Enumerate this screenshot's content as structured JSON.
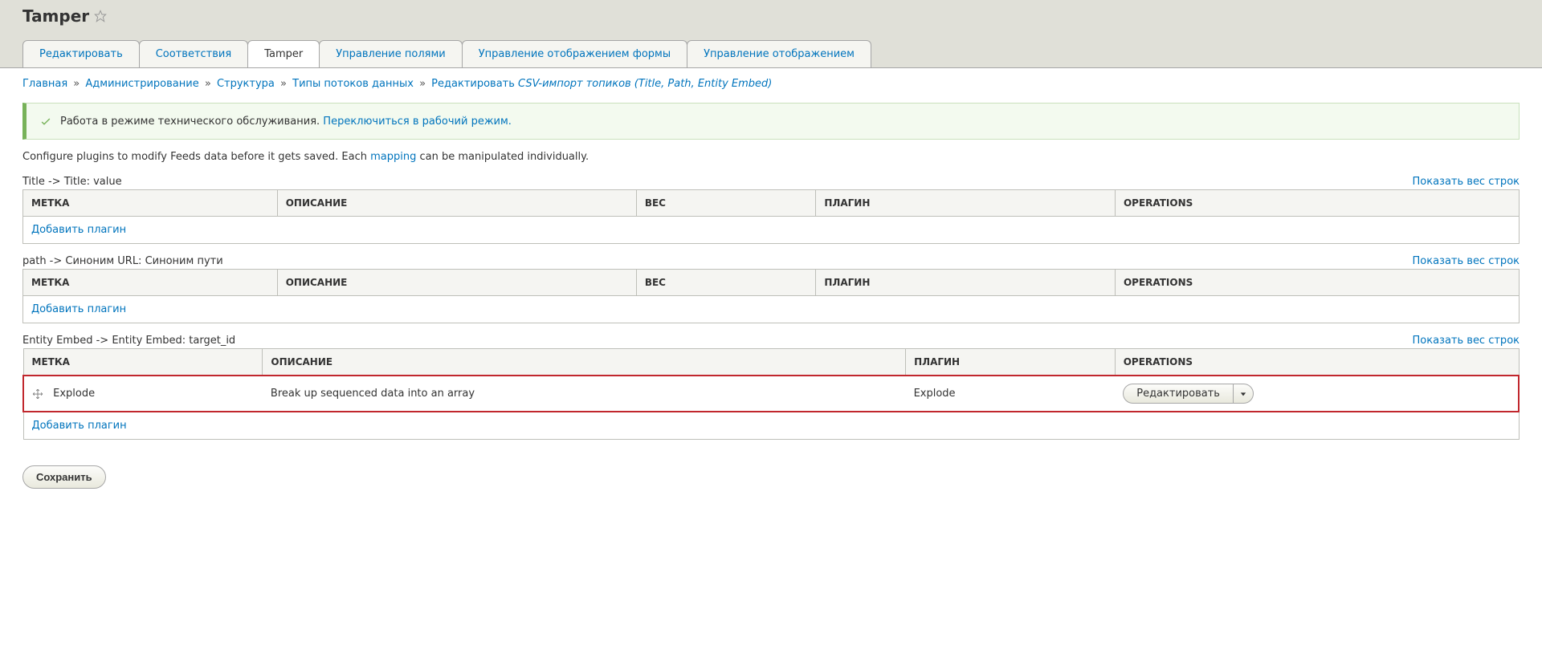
{
  "header": {
    "title": "Tamper"
  },
  "tabs": [
    {
      "label": "Редактировать",
      "active": false
    },
    {
      "label": "Соответствия",
      "active": false
    },
    {
      "label": "Tamper",
      "active": true
    },
    {
      "label": "Управление полями",
      "active": false
    },
    {
      "label": "Управление отображением формы",
      "active": false
    },
    {
      "label": "Управление отображением",
      "active": false
    }
  ],
  "breadcrumb": {
    "items": [
      {
        "label": "Главная"
      },
      {
        "label": "Администрирование"
      },
      {
        "label": "Структура"
      },
      {
        "label": "Типы потоков данных"
      }
    ],
    "last_prefix": "Редактировать ",
    "last_em": "CSV-импорт топиков (Title, Path, Entity Embed)"
  },
  "status": {
    "text": "Работа в режиме технического обслуживания. ",
    "link": "Переключиться в рабочий режим."
  },
  "description": {
    "before": "Configure plugins to modify Feeds data before it gets saved. Each ",
    "link": "mapping",
    "after": " can be manipulated individually."
  },
  "weight_link": "Показать вес строк",
  "add_plugin": "Добавить плагин",
  "columns_4": {
    "label": "МЕТКА",
    "desc": "ОПИСАНИЕ",
    "weight": "ВЕС",
    "plugin": "ПЛАГИН",
    "ops": "OPERATIONS"
  },
  "columns_3": {
    "label": "МЕТКА",
    "desc": "ОПИСАНИЕ",
    "plugin": "ПЛАГИН",
    "ops": "OPERATIONS"
  },
  "sections": [
    {
      "caption": "Title -> Title: value"
    },
    {
      "caption": "path -> Синоним URL: Синоним пути"
    }
  ],
  "section3": {
    "caption": "Entity Embed -> Entity Embed: target_id",
    "row": {
      "label": "Explode",
      "desc": "Break up sequenced data into an array",
      "plugin": "Explode",
      "op": "Редактировать"
    }
  },
  "save": "Сохранить"
}
